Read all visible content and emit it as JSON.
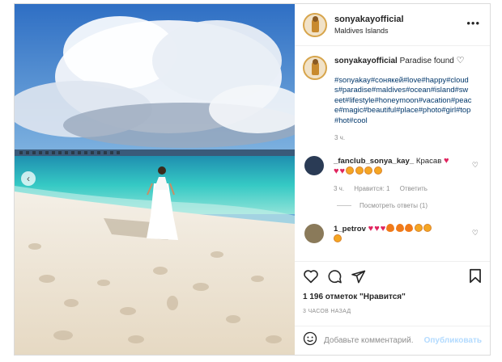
{
  "post": {
    "username": "sonyakayofficial",
    "location": "Maldives Islands",
    "caption": "Paradise found",
    "hashtags": "#sonyakay#сонякей#love#happy#clouds#paradise#maldives#ocean#island#sweet#lifestyle#honeymoon#vacation#peace#magic#beautiful#place#photo#girl#top#hot#cool",
    "caption_time": "3 ч.",
    "likes": "1 196 отметок \"Нравится\"",
    "posted_ago": "3 ЧАСОВ НАЗАД"
  },
  "comments": [
    {
      "username": "_fanclub_sonya_kay_",
      "text": "Красав",
      "time": "3 ч.",
      "likes": "Нравится: 1",
      "reply": "Ответить",
      "avatar_color": "#2a3b55"
    },
    {
      "username": "1_petrov",
      "text": "",
      "avatar_color": "#8a7a5a"
    }
  ],
  "view_replies": "Посмотреть ответы (1)",
  "add_comment": {
    "placeholder": "Добавьте комментарий...",
    "publish": "Опубликовать"
  },
  "icons": {
    "more": "more-icon",
    "like": "heart-icon",
    "comment": "comment-icon",
    "share": "share-icon",
    "save": "bookmark-icon",
    "emoji": "emoji-icon",
    "prev": "chevron-left-icon"
  },
  "colors": {
    "link": "#00376b",
    "heart": "#e0245e",
    "muted": "#8e8e8e",
    "publish_disabled": "#b3dbff"
  }
}
